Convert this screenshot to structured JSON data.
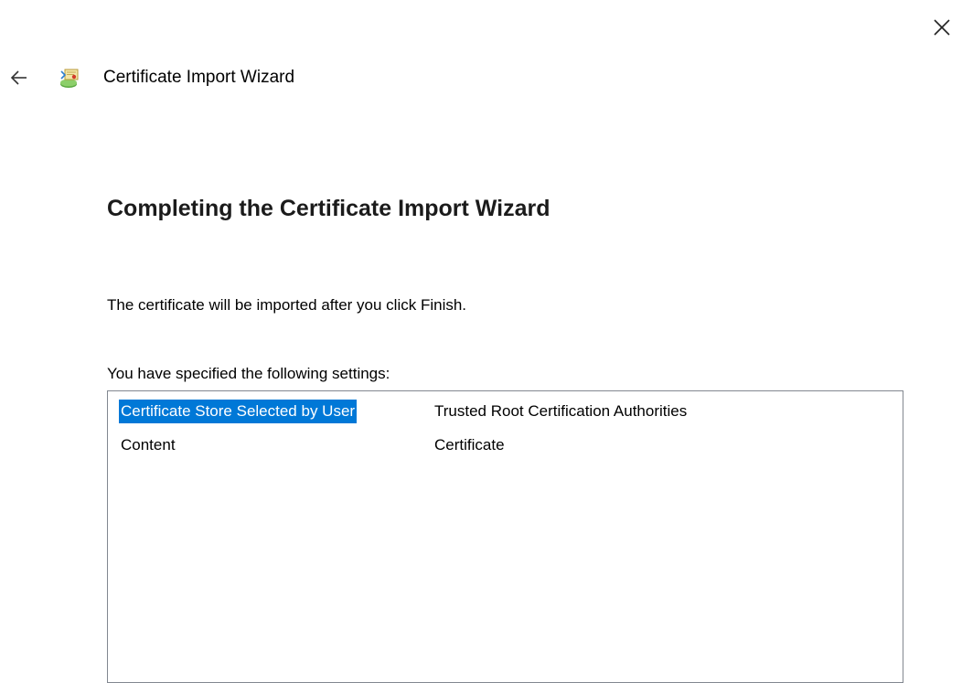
{
  "window": {
    "title": "Certificate Import Wizard",
    "close_icon": "close-icon",
    "back_icon": "back-arrow-icon",
    "app_icon": "certificate-wizard-icon"
  },
  "main": {
    "heading": "Completing the Certificate Import Wizard",
    "info": "The certificate will be imported after you click Finish.",
    "settings_label": "You have specified the following settings:",
    "settings": [
      {
        "key": "Certificate Store Selected by User",
        "value": "Trusted Root Certification Authorities",
        "selected": true
      },
      {
        "key": "Content",
        "value": "Certificate",
        "selected": false
      }
    ]
  },
  "colors": {
    "selection": "#0078d7",
    "border": "#828790"
  }
}
